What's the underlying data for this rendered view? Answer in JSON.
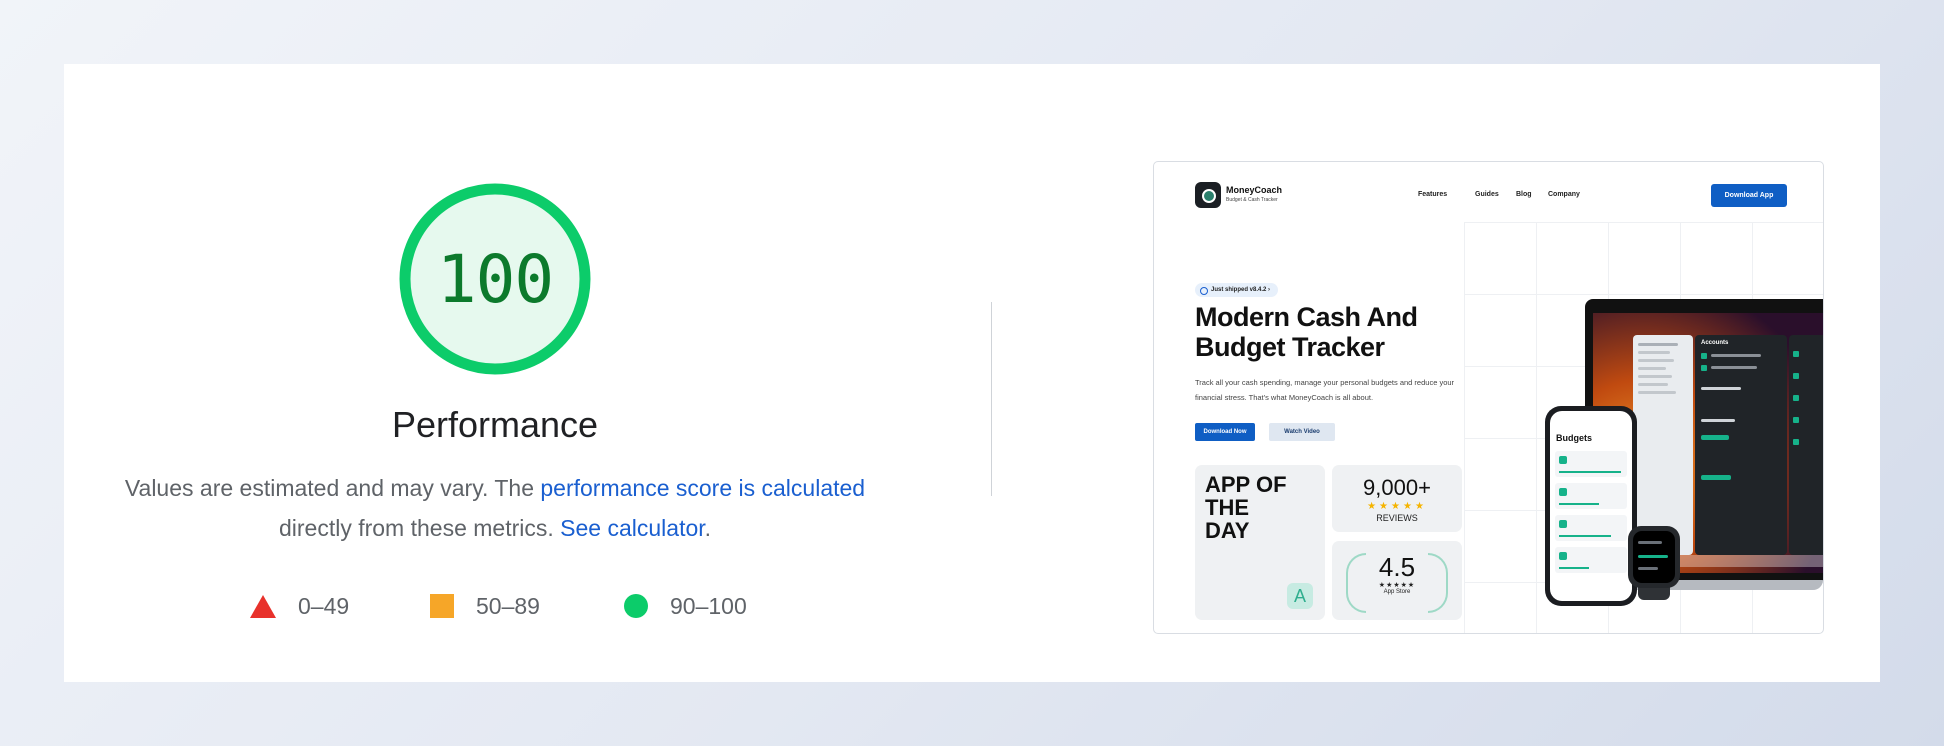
{
  "score": {
    "value": "100",
    "fraction": 1.0,
    "title": "Performance",
    "color": "#0ccc6a"
  },
  "description": {
    "text_before": "Values are estimated and may vary. The ",
    "link1": "performance score is calculated",
    "text_mid": " directly from these metrics. ",
    "link2": "See calculator",
    "text_end": "."
  },
  "legend": [
    {
      "range": "0–49",
      "shape": "triangle",
      "color": "#e8312b"
    },
    {
      "range": "50–89",
      "shape": "square",
      "color": "#f6a628"
    },
    {
      "range": "90–100",
      "shape": "circle",
      "color": "#0ccc6a"
    }
  ],
  "screenshot": {
    "brand": "MoneyCoach",
    "brand_sub": "Budget & Cash Tracker",
    "nav": [
      "Features",
      "Guides",
      "Blog",
      "Company"
    ],
    "download_button": "Download App",
    "pill": "Just shipped v8.4.2  ›",
    "headline": "Modern Cash And Budget Tracker",
    "subtext": "Track all your cash spending, manage your personal budgets and reduce your financial stress. That's what MoneyCoach is all about.",
    "cta_primary": "Download Now",
    "cta_secondary": "Watch Video",
    "award": "APP OF THE DAY",
    "reviews_count": "9,000+",
    "reviews_stars": "★★★★★",
    "reviews_label": "REVIEWS",
    "rating": "4.5",
    "rating_stars": "★★★★★",
    "rating_label": "App Store",
    "phone_title": "Budgets",
    "panel_title": "Accounts"
  }
}
